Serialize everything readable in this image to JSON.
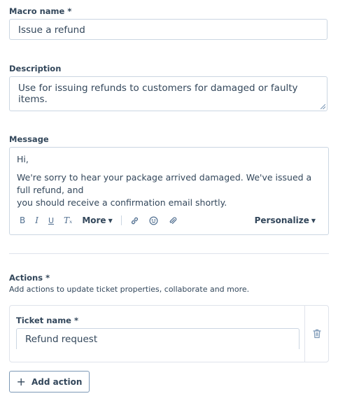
{
  "macro": {
    "label": "Macro name *",
    "value": "Issue a refund"
  },
  "description": {
    "label": "Description",
    "value": "Use for issuing refunds to customers for damaged or faulty items."
  },
  "message": {
    "label": "Message",
    "lines": [
      "Hi,",
      "",
      "We're sorry to hear your package arrived damaged. We've issued a full refund, and",
      "you should receive a confirmation email shortly."
    ],
    "toolbar": {
      "bold": "B",
      "italic": "I",
      "underline": "U",
      "clear_format": "Tₓ",
      "more": "More",
      "personalize": "Personalize",
      "icons": [
        "link-icon",
        "emoji-icon",
        "attachment-icon"
      ]
    }
  },
  "actions": {
    "label": "Actions *",
    "helper": "Add actions to update ticket properties, collaborate and more.",
    "ticket": {
      "label": "Ticket name *",
      "value": "Refund request"
    },
    "add_button": "Add action"
  }
}
